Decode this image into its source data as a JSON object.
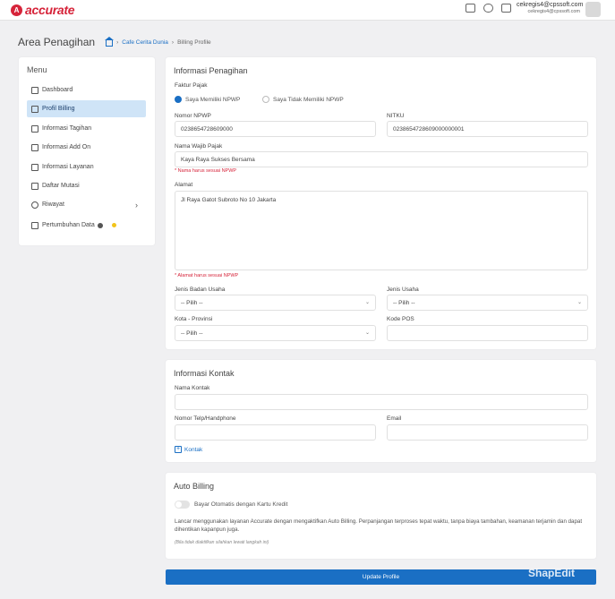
{
  "app": {
    "logo_mark": "A",
    "logo_text": "accurate"
  },
  "topbar": {
    "icons": [
      "card-icon",
      "database-icon",
      "printer-icon"
    ],
    "user_primary": "cekregis4@cpssoft.com",
    "user_secondary": "cekregis4@cpssoft.com"
  },
  "page": {
    "title": "Area Penagihan"
  },
  "breadcrumb": {
    "link": "Cafe Cerita Dunia",
    "current": "Billing Profile"
  },
  "sidebar": {
    "title": "Menu",
    "items": [
      {
        "label": "Dashboard",
        "icon": "dashboard-icon"
      },
      {
        "label": "Profil Billing",
        "icon": "profile-icon"
      },
      {
        "label": "Informasi Tagihan",
        "icon": "invoice-icon"
      },
      {
        "label": "Informasi Add On",
        "icon": "addon-icon"
      },
      {
        "label": "Informasi Layanan",
        "icon": "service-icon"
      },
      {
        "label": "Daftar Mutasi",
        "icon": "clipboard-icon"
      },
      {
        "label": "Riwayat",
        "icon": "history-icon"
      },
      {
        "label": "Pertumbuhan Data",
        "icon": "chart-icon"
      }
    ]
  },
  "billing_info": {
    "title": "Informasi Penagihan",
    "faktur_label": "Faktur Pajak",
    "radio_npwp": "Saya Memiliki NPWP",
    "radio_no_npwp": "Saya Tidak Memiliki NPWP",
    "npwp_label": "Nomor NPWP",
    "npwp_value": "0238654728609000",
    "nitku_label": "NITKU",
    "nitku_value": "0238654728609000000001",
    "taxpayer_label": "Nama Wajib Pajak",
    "taxpayer_value": "Kaya Raya Sukses Bersama",
    "taxpayer_hint": "* Nama harus sesuai NPWP",
    "address_label": "Alamat",
    "address_value": "Jl Raya Gatot Subroto No 10 Jakarta",
    "address_hint": "* Alamat harus sesuai NPWP",
    "entity_label": "Jenis Badan Usaha",
    "entity_value": "-- Pilih --",
    "business_label": "Jenis Usaha",
    "business_value": "-- Pilih --",
    "city_label": "Kota - Provinsi",
    "city_value": "-- Pilih --",
    "postal_label": "Kode POS",
    "postal_value": ""
  },
  "contact": {
    "title": "Informasi Kontak",
    "name_label": "Nama Kontak",
    "phone_label": "Nomor Telp/Handphone",
    "email_label": "Email",
    "add_label": "Kontak"
  },
  "auto_billing": {
    "title": "Auto Billing",
    "toggle_label": "Bayar Otomatis dengan Kartu Kredit",
    "description": "Lancar menggunakan layanan Accurate dengan mengaktifkan Auto Billing. Perpanjangan terproses tepat waktu, tanpa biaya tambahan, keamanan terjamin dan dapat dihentikan kapanpun juga.",
    "note": "(Bila tidak diaktifkan silahkan lewati langkah ini)"
  },
  "actions": {
    "update_label": "Update Profile"
  },
  "watermark": "ShapEdit",
  "colors": {
    "accent": "#1a6fc4",
    "brand": "#d6243a",
    "active_bg": "#cfe4f7",
    "warning": "#f2c41a"
  }
}
